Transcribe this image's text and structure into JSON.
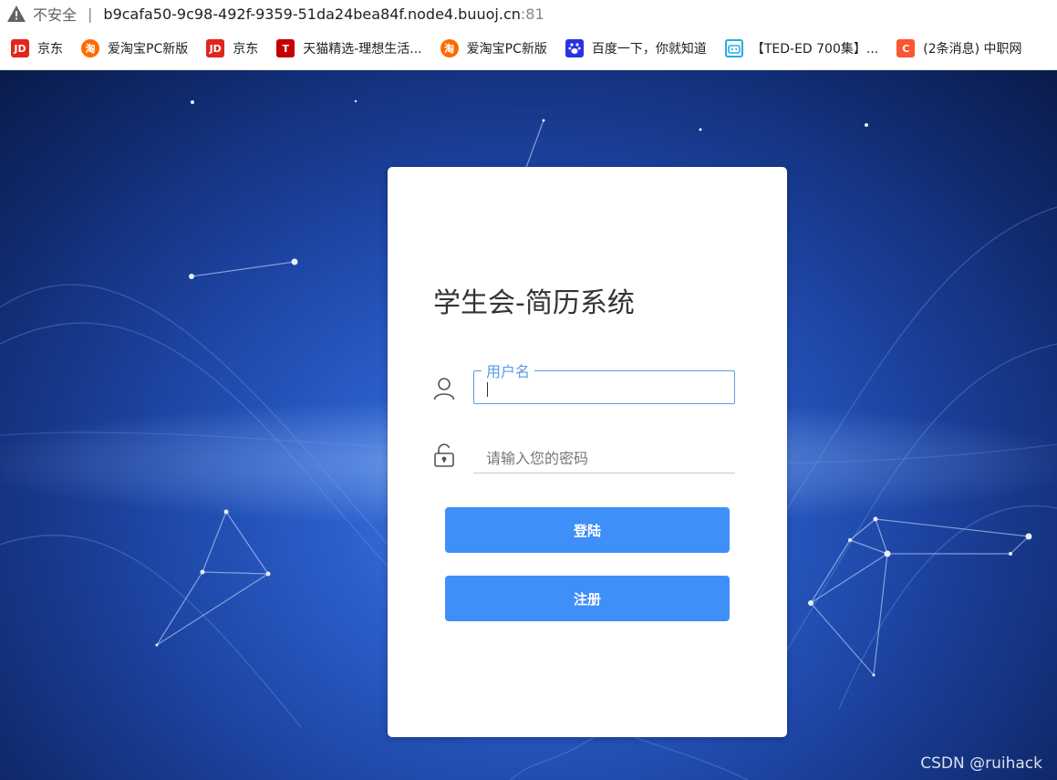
{
  "browser": {
    "security_label": "不安全",
    "host": "b9cafa50-9c98-492f-9359-51da24bea84f.node4.buuoj.cn",
    "port": ":81",
    "bookmarks": [
      {
        "icon": "jd-icon",
        "label": "京东"
      },
      {
        "icon": "taobao-icon",
        "label": "爱淘宝PC新版"
      },
      {
        "icon": "jd-icon",
        "label": "京东"
      },
      {
        "icon": "tmall-icon",
        "label": "天猫精选-理想生活..."
      },
      {
        "icon": "taobao-icon",
        "label": "爱淘宝PC新版"
      },
      {
        "icon": "baidu-icon",
        "label": "百度一下，你就知道"
      },
      {
        "icon": "bilibili-icon",
        "label": "【TED-ED 700集】..."
      },
      {
        "icon": "csdn-icon",
        "label": "(2条消息) 中职网"
      }
    ]
  },
  "login": {
    "title": "学生会-简历系统",
    "username_label": "用户名",
    "username_value": "",
    "password_placeholder": "请输入您的密码",
    "login_button": "登陆",
    "register_button": "注册"
  },
  "watermark": "CSDN @ruihack",
  "colors": {
    "accent": "#3f8ff9",
    "field_focus": "#5b9be8"
  }
}
